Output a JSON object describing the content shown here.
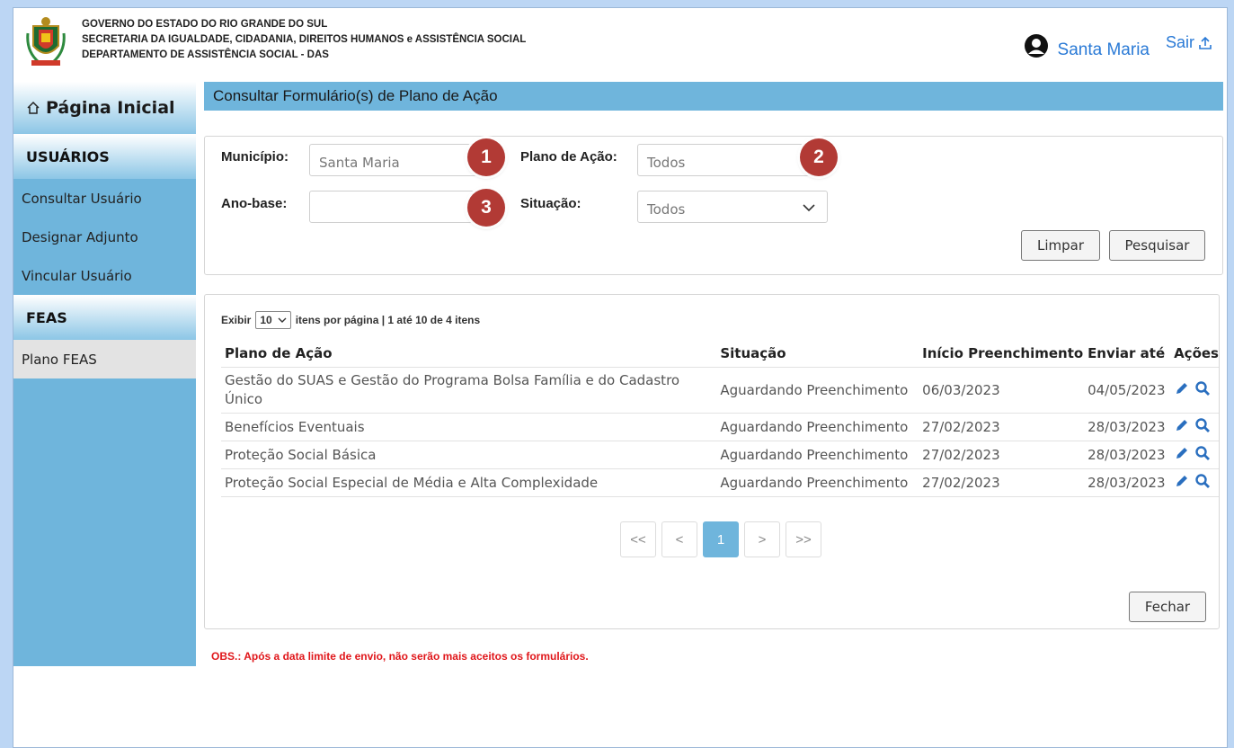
{
  "header": {
    "lines": [
      "GOVERNO DO ESTADO DO RIO GRANDE DO SUL",
      "SECRETARIA DA IGUALDADE, CIDADANIA, DIREITOS HUMANOS e ASSISTÊNCIA SOCIAL",
      "DEPARTAMENTO DE ASSISTÊNCIA SOCIAL - DAS"
    ],
    "user_name": "Santa Maria",
    "logout_label": "Sair"
  },
  "sidebar": {
    "home_label": "Página Inicial",
    "sections": [
      {
        "title": "USUÁRIOS",
        "items": [
          "Consultar Usuário",
          "Designar Adjunto",
          "Vincular Usuário"
        ]
      },
      {
        "title": "FEAS",
        "items": [
          "Plano FEAS"
        ]
      }
    ]
  },
  "page_title": "Consultar Formulário(s) de Plano de Ação",
  "filters": {
    "municipio_label": "Município:",
    "municipio_value": "Santa Maria",
    "plano_label": "Plano de Ação:",
    "plano_value": "Todos",
    "ano_label": "Ano-base:",
    "ano_value": "",
    "situacao_label": "Situação:",
    "situacao_value": "Todos",
    "clear_label": "Limpar",
    "search_label": "Pesquisar"
  },
  "badges": [
    "1",
    "2",
    "3"
  ],
  "results": {
    "exibir_label": "Exibir",
    "page_size": "10",
    "info": "itens por página | 1 até 10 de 4 itens",
    "columns": [
      "Plano de Ação",
      "Situação",
      "Início Preenchimento",
      "Enviar até",
      "Ações"
    ],
    "rows": [
      [
        "Gestão do SUAS e Gestão do Programa Bolsa Família e do Cadastro Único",
        "Aguardando Preenchimento",
        "06/03/2023",
        "04/05/2023"
      ],
      [
        "Benefícios Eventuais",
        "Aguardando Preenchimento",
        "27/02/2023",
        "28/03/2023"
      ],
      [
        "Proteção Social Básica",
        "Aguardando Preenchimento",
        "27/02/2023",
        "28/03/2023"
      ],
      [
        "Proteção Social Especial de Média e Alta Complexidade",
        "Aguardando Preenchimento",
        "27/02/2023",
        "28/03/2023"
      ]
    ],
    "pager": {
      "first": "<<",
      "prev": "<",
      "current": "1",
      "next": ">",
      "last": ">>"
    },
    "close_label": "Fechar"
  },
  "obs": "OBS.: Após a data limite de envio, não serão mais aceitos os formulários.",
  "colors": {
    "accent": "#6fb5dc",
    "link": "#2a7ad6",
    "badge": "#b23a35",
    "warning": "#e0161a"
  },
  "icons": [
    "coat-of-arms",
    "user-circle-icon",
    "logout-icon",
    "home-icon",
    "chevron-down-icon",
    "pencil-icon",
    "search-icon"
  ]
}
